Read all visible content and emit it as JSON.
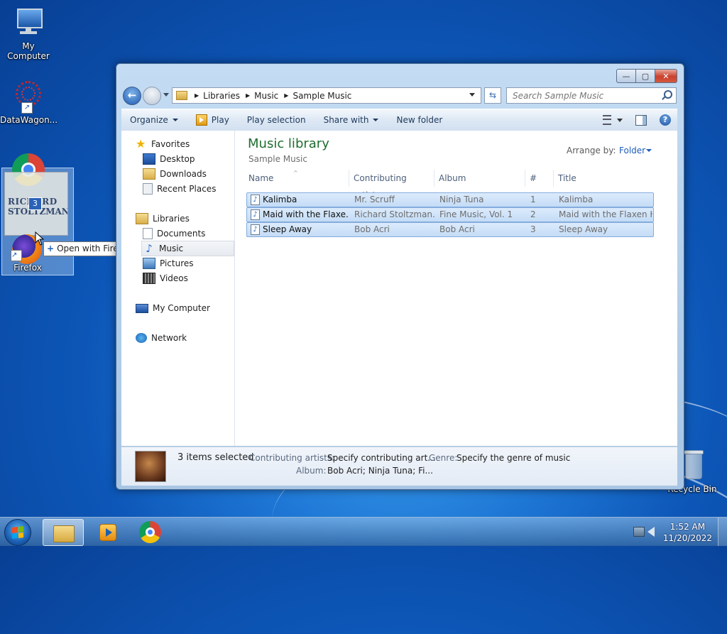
{
  "desktop": {
    "icons": [
      {
        "label": "My Computer"
      },
      {
        "label": "DataWagon..."
      },
      {
        "label": "Firefox"
      },
      {
        "label": "Recycle Bin"
      }
    ],
    "drag": {
      "thumb_line1": "RICHARD",
      "thumb_line2": "STOLTZMAN",
      "count": "3",
      "tooltip": "Open with Firefox"
    }
  },
  "window": {
    "caption": {
      "minimize": "—",
      "maximize": "▢",
      "close": "✕"
    },
    "breadcrumb": [
      "Libraries",
      "Music",
      "Sample Music"
    ],
    "search_placeholder": "Search Sample Music",
    "toolbar": {
      "organize": "Organize",
      "play": "Play",
      "play_selection": "Play selection",
      "share_with": "Share with",
      "new_folder": "New folder"
    },
    "nav": {
      "favorites": "Favorites",
      "desktop": "Desktop",
      "downloads": "Downloads",
      "recent_places": "Recent Places",
      "libraries": "Libraries",
      "documents": "Documents",
      "music": "Music",
      "pictures": "Pictures",
      "videos": "Videos",
      "my_computer": "My Computer",
      "network": "Network"
    },
    "library": {
      "title": "Music library",
      "subtitle": "Sample Music",
      "arrange_label": "Arrange by:",
      "arrange_value": "Folder"
    },
    "columns": [
      "Name",
      "Contributing artists",
      "Album",
      "#",
      "Title"
    ],
    "rows": [
      {
        "name": "Kalimba",
        "artist": "Mr. Scruff",
        "album": "Ninja Tuna",
        "num": "1",
        "title": "Kalimba"
      },
      {
        "name": "Maid with the Flaxe...",
        "artist": "Richard Stoltzman...",
        "album": "Fine Music, Vol. 1",
        "num": "2",
        "title": "Maid with the Flaxen H..."
      },
      {
        "name": "Sleep Away",
        "artist": "Bob Acri",
        "album": "Bob Acri",
        "num": "3",
        "title": "Sleep Away"
      }
    ],
    "details": {
      "count": "3 items selected",
      "artists_label": "Contributing artists:",
      "artists_value": "Specify contributing art...",
      "genre_label": "Genre:",
      "genre_value": "Specify the genre of music",
      "album_label": "Album:",
      "album_value": "Bob Acri; Ninja Tuna; Fi..."
    }
  },
  "taskbar": {
    "time": "1:52 AM",
    "date": "11/20/2022"
  }
}
